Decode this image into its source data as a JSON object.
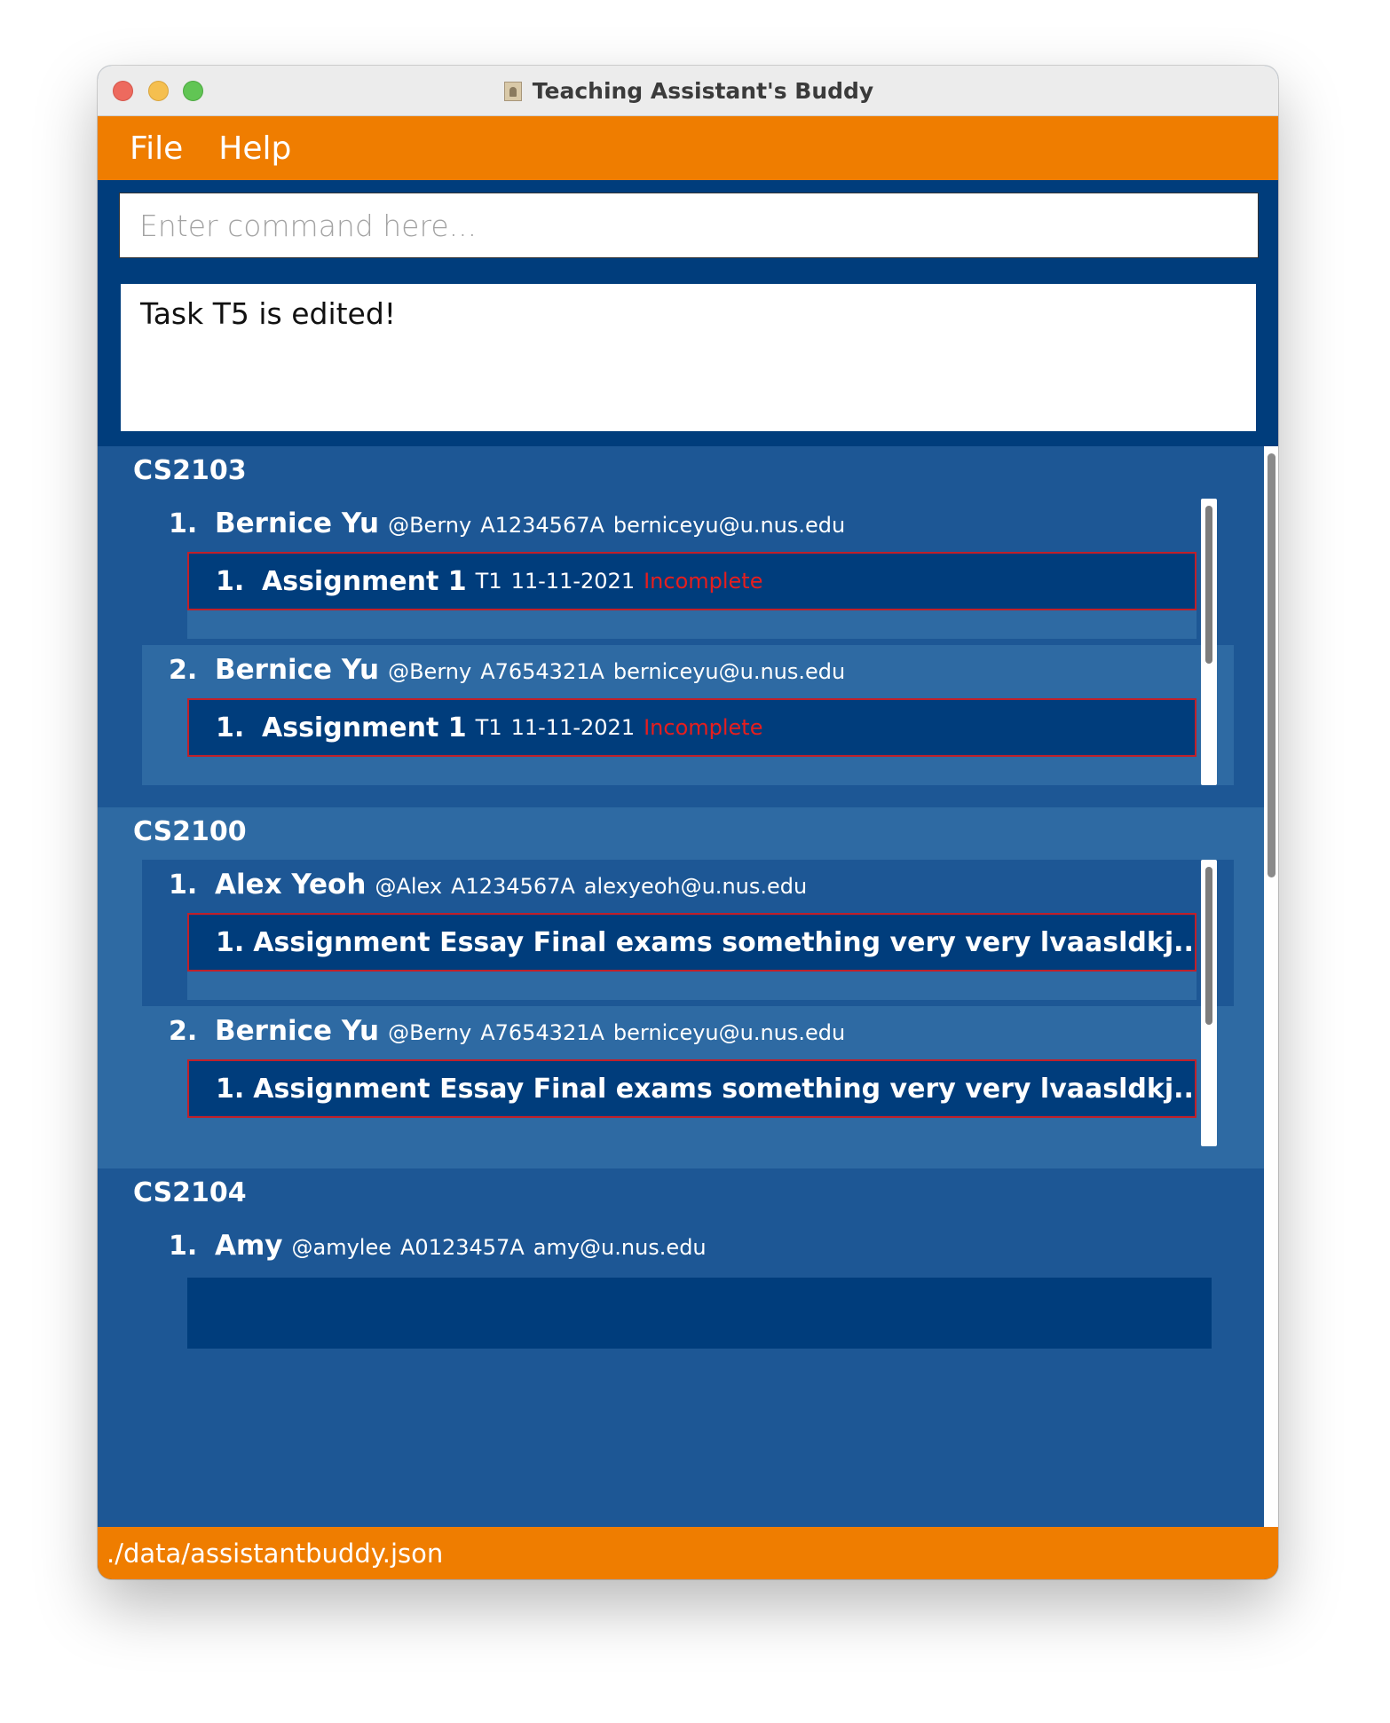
{
  "window": {
    "title": "Teaching Assistant's Buddy"
  },
  "menu": {
    "file": "File",
    "help": "Help"
  },
  "command": {
    "placeholder": "Enter command here...",
    "value": ""
  },
  "result": {
    "text": "Task T5 is edited!"
  },
  "groups": [
    {
      "title": "CS2103",
      "students": [
        {
          "index": "1.",
          "name": "Bernice Yu",
          "tele": "@Berny",
          "id": "A1234567A",
          "email": "berniceyu@u.nus.edu",
          "tasks": [
            {
              "index": "1.",
              "name": "Assignment 1",
              "tag": "T1",
              "date": "11-11-2021",
              "status": "Incomplete"
            }
          ]
        },
        {
          "index": "2.",
          "name": "Bernice Yu",
          "tele": "@Berny",
          "id": "A7654321A",
          "email": "berniceyu@u.nus.edu",
          "tasks": [
            {
              "index": "1.",
              "name": "Assignment 1",
              "tag": "T1",
              "date": "11-11-2021",
              "status": "Incomplete"
            }
          ]
        }
      ]
    },
    {
      "title": "CS2100",
      "students": [
        {
          "index": "1.",
          "name": "Alex Yeoh",
          "tele": "@Alex",
          "id": "A1234567A",
          "email": "alexyeoh@u.nus.edu",
          "tasks": [
            {
              "index": "1.",
              "name": "Assignment Essay Final exams something very very lvaasldkj...",
              "tag": "...",
              "date": "...",
              "status": "..."
            }
          ]
        },
        {
          "index": "2.",
          "name": "Bernice Yu",
          "tele": "@Berny",
          "id": "A7654321A",
          "email": "berniceyu@u.nus.edu",
          "tasks": [
            {
              "index": "1.",
              "name": "Assignment Essay Final exams something very very lvaasldkj...",
              "tag": "...",
              "date": "...",
              "status": "..."
            }
          ]
        }
      ]
    },
    {
      "title": "CS2104",
      "students": [
        {
          "index": "1.",
          "name": "Amy",
          "tele": "@amylee",
          "id": "A0123457A",
          "email": "amy@u.nus.edu",
          "tasks": []
        }
      ]
    }
  ],
  "status": {
    "path": "./data/assistantbuddy.json"
  },
  "colors": {
    "accent": "#ef7d00",
    "dark_blue": "#003d7c",
    "mid_blue": "#1d5795",
    "light_blue": "#2e6aa3",
    "incomplete": "#e61e1e"
  }
}
